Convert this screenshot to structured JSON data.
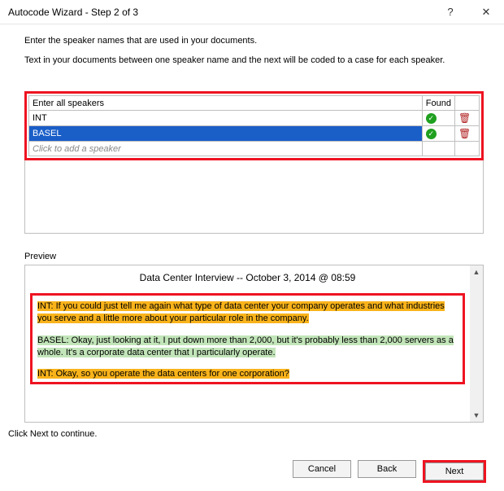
{
  "window": {
    "title": "Autocode Wizard - Step 2 of 3",
    "help": "?",
    "close": "✕"
  },
  "instr": {
    "line1": "Enter the speaker names that are used in your documents.",
    "line2": "Text in your documents between one speaker name and the next will be coded to a case for each speaker."
  },
  "speakers": {
    "col_name": "Enter all speakers",
    "col_found": "Found",
    "rows": [
      {
        "name": "INT",
        "found": true,
        "selected": false
      },
      {
        "name": "BASEL",
        "found": true,
        "selected": true
      }
    ],
    "add_placeholder": "Click to add a speaker"
  },
  "preview": {
    "label": "Preview",
    "title": "Data Center Interview -- October 3, 2014 @ 08:59",
    "p1_speaker": "INT:",
    "p1_text": "  If you could just tell me again what type of data center your company operates and what industries you serve and a little more about your particular role in the company.",
    "p2_speaker": "BASEL:",
    "p2_text": "  Okay, just looking at it, I put down more than 2,000, but it's probably less than 2,000 servers as a whole. It's a corporate data center that I particularly operate.",
    "p3_speaker": "INT:",
    "p3_text": "  Okay, so you operate the data centers for one corporation?"
  },
  "footer": {
    "note": "Click Next to continue.",
    "cancel": "Cancel",
    "back": "Back",
    "next": "Next"
  }
}
